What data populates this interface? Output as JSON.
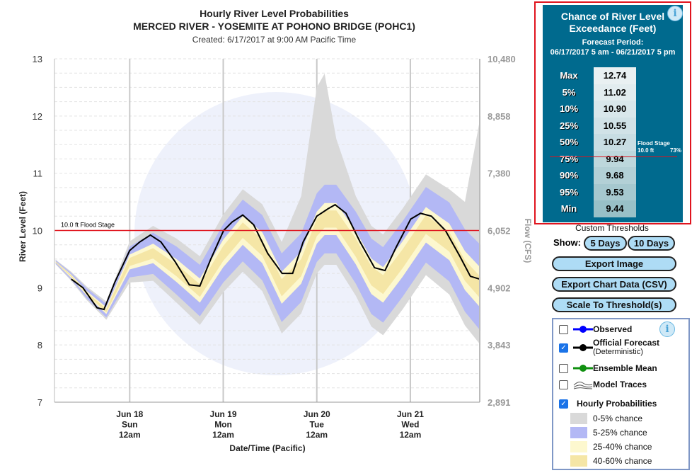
{
  "header": {
    "title": "Hourly River Level Probabilities",
    "subtitle": "MERCED RIVER - YOSEMITE AT POHONO BRIDGE (POHC1)",
    "created": "Created: 6/17/2017 at 9:00 AM Pacific Time"
  },
  "chart_data": {
    "type": "area",
    "title": "Hourly River Level Probabilities",
    "xlabel": "Date/Time (Pacific)",
    "ylabel": "River Level (Feet)",
    "y2label": "Flow (CFS)",
    "ylim": [
      7,
      13
    ],
    "yticks": [
      7,
      8,
      9,
      10,
      11,
      12,
      13
    ],
    "y2ticks": [
      "2,891",
      "3,843",
      "4,902",
      "6,052",
      "7,380",
      "8,858",
      "10,480"
    ],
    "x_unit": "hours after 6/17/2017 12am",
    "xlim": [
      4.7,
      113.8
    ],
    "xticks": [
      {
        "hour": 24,
        "label": [
          "Jun 18",
          "Sun",
          "12am"
        ]
      },
      {
        "hour": 48,
        "label": [
          "Jun 19",
          "Mon",
          "12am"
        ]
      },
      {
        "hour": 72,
        "label": [
          "Jun 20",
          "Tue",
          "12am"
        ]
      },
      {
        "hour": 96,
        "label": [
          "Jun 21",
          "Wed",
          "12am"
        ]
      }
    ],
    "flood_stage": {
      "value": 10,
      "label": "10.0 ft Flood Stage",
      "color": "#e0141e"
    },
    "band_colors": {
      "0-5%": "#d9d9d9",
      "5-25%": "#b3b8f5",
      "25-40%": "#fdf8cf",
      "40-60%": "#f5e6a6"
    },
    "percentiles": {
      "hours": [
        5,
        9,
        13,
        18,
        24,
        30,
        36,
        42,
        48,
        53,
        58,
        63,
        68,
        72,
        74,
        77,
        82,
        86,
        89,
        94,
        100,
        106,
        110,
        114
      ],
      "min": [
        9.41,
        9.12,
        8.78,
        8.44,
        9.09,
        9.12,
        8.74,
        8.35,
        8.92,
        9.28,
        8.94,
        8.2,
        8.55,
        9.25,
        9.4,
        9.4,
        8.86,
        8.32,
        8.17,
        8.62,
        9.22,
        8.88,
        8.34,
        8.0
      ],
      "p05": [
        9.42,
        9.14,
        8.81,
        8.48,
        9.18,
        9.24,
        8.88,
        8.5,
        9.09,
        9.46,
        9.13,
        8.4,
        8.75,
        9.45,
        9.6,
        9.6,
        9.07,
        8.54,
        8.39,
        8.84,
        9.44,
        9.11,
        8.58,
        8.25
      ],
      "p25": [
        9.44,
        9.17,
        8.86,
        8.54,
        9.32,
        9.43,
        9.1,
        8.74,
        9.36,
        9.75,
        9.43,
        8.72,
        9.07,
        9.77,
        9.92,
        9.92,
        9.41,
        8.89,
        8.74,
        9.19,
        9.79,
        9.48,
        8.96,
        8.65
      ],
      "p40": [
        9.44,
        9.19,
        8.88,
        8.57,
        9.38,
        9.51,
        9.2,
        8.84,
        9.47,
        9.87,
        9.56,
        8.85,
        9.2,
        9.9,
        10.05,
        10.05,
        9.54,
        9.04,
        8.89,
        9.34,
        9.94,
        9.63,
        9.12,
        8.81
      ],
      "p60": [
        9.46,
        9.22,
        8.92,
        8.63,
        9.52,
        9.69,
        9.41,
        9.06,
        9.73,
        10.14,
        9.84,
        9.15,
        9.5,
        10.2,
        10.35,
        10.35,
        9.86,
        9.37,
        9.22,
        9.67,
        10.27,
        9.97,
        9.48,
        9.19
      ],
      "p75": [
        9.46,
        9.23,
        8.94,
        8.66,
        9.58,
        9.77,
        9.5,
        9.16,
        9.84,
        10.25,
        9.97,
        9.28,
        9.63,
        10.33,
        10.48,
        10.48,
        9.99,
        9.51,
        9.36,
        9.81,
        10.41,
        10.12,
        9.64,
        9.35
      ],
      "p95": [
        9.48,
        9.26,
        8.99,
        8.72,
        9.72,
        9.96,
        9.72,
        9.4,
        10.11,
        10.54,
        10.27,
        9.6,
        9.95,
        10.65,
        10.8,
        10.8,
        10.33,
        9.86,
        9.71,
        10.16,
        10.76,
        10.49,
        10.02,
        9.75
      ],
      "max": [
        9.49,
        9.28,
        9.02,
        8.76,
        9.81,
        10.08,
        9.86,
        9.55,
        10.28,
        10.72,
        10.46,
        9.8,
        10.6,
        12.5,
        12.74,
        11.6,
        10.6,
        10.08,
        9.93,
        10.38,
        10.98,
        10.72,
        10.5,
        12.0
      ]
    },
    "series": [
      {
        "name": "Official Forecast (Deterministic)",
        "color": "#000000",
        "hours": [
          9,
          12,
          15.6,
          17.4,
          20.2,
          24,
          26.6,
          29.3,
          32,
          35.7,
          39.3,
          42,
          44.8,
          48.1,
          50.3,
          53,
          55.8,
          59.4,
          63.1,
          65.8,
          68.5,
          72,
          74.9,
          76.7,
          79.5,
          83.1,
          86.8,
          89.5,
          92.3,
          96.1,
          98.6,
          101.4,
          105,
          108.7,
          111.4,
          113.8
        ],
        "values": [
          9.15,
          9.0,
          8.65,
          8.62,
          9.1,
          9.65,
          9.8,
          9.92,
          9.8,
          9.45,
          9.05,
          9.03,
          9.5,
          10.0,
          10.15,
          10.27,
          10.1,
          9.6,
          9.25,
          9.25,
          9.8,
          10.25,
          10.38,
          10.45,
          10.3,
          9.8,
          9.35,
          9.3,
          9.7,
          10.2,
          10.3,
          10.25,
          10.0,
          9.55,
          9.2,
          9.15
        ]
      }
    ]
  },
  "exceedance": {
    "title": "Chance of River Level Exceedance (Feet)",
    "period_label": "Forecast Period:",
    "period": "06/17/2017 5 am - 06/21/2017 5 pm",
    "rows": [
      {
        "label": "Max",
        "value": "12.74"
      },
      {
        "label": "5%",
        "value": "11.02"
      },
      {
        "label": "10%",
        "value": "10.90"
      },
      {
        "label": "25%",
        "value": "10.55"
      },
      {
        "label": "50%",
        "value": "10.27"
      },
      {
        "label": "75%",
        "value": "9.94"
      },
      {
        "label": "90%",
        "value": "9.68"
      },
      {
        "label": "95%",
        "value": "9.53"
      },
      {
        "label": "Min",
        "value": "9.44"
      }
    ],
    "flood_label": "Flood Stage",
    "flood_value": "10.0 ft",
    "flood_pct": "73%"
  },
  "controls": {
    "custom_thresholds": "Custom Thresholds",
    "show": "Show:",
    "days5": "5 Days",
    "days10": "10 Days",
    "export_image": "Export Image",
    "export_csv": "Export Chart Data (CSV)",
    "scale": "Scale To Threshold(s)"
  },
  "legend": {
    "observed": "Observed",
    "official": "Official Forecast",
    "official_sub": "(Deterministic)",
    "ensemble": "Ensemble Mean",
    "traces": "Model Traces",
    "hourly": "Hourly Probabilities",
    "bands": [
      "0-5% chance",
      "5-25% chance",
      "25-40% chance",
      "40-60% chance"
    ],
    "checked": {
      "observed": false,
      "official": true,
      "ensemble": false,
      "traces": false,
      "hourly": true
    }
  }
}
